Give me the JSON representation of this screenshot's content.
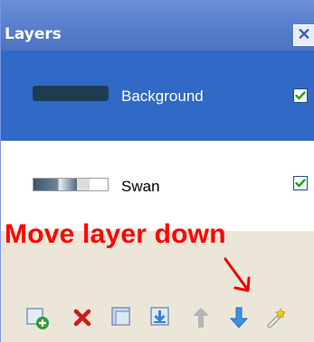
{
  "window": {
    "title": "Layers",
    "close_glyph": "✕"
  },
  "layers": [
    {
      "name": "Background",
      "visible": true,
      "selected": true,
      "thumbnail_icon": "background-thumbnail"
    },
    {
      "name": "Swan",
      "visible": true,
      "selected": false,
      "thumbnail_icon": "swan-thumbnail"
    }
  ],
  "annotation": {
    "text": "Move layer down",
    "color": "#ff0000"
  },
  "toolbar": {
    "buttons": [
      {
        "icon": "add-layer-icon"
      },
      {
        "icon": "delete-layer-icon"
      },
      {
        "icon": "duplicate-layer-icon"
      },
      {
        "icon": "merge-layer-down-icon"
      },
      {
        "icon": "move-layer-up-icon"
      },
      {
        "icon": "move-layer-down-icon"
      },
      {
        "icon": "layer-properties-icon"
      }
    ]
  },
  "colors": {
    "selection": "#3169c6",
    "titlebar": "#5b82cf",
    "tray": "#ebe6d8"
  }
}
